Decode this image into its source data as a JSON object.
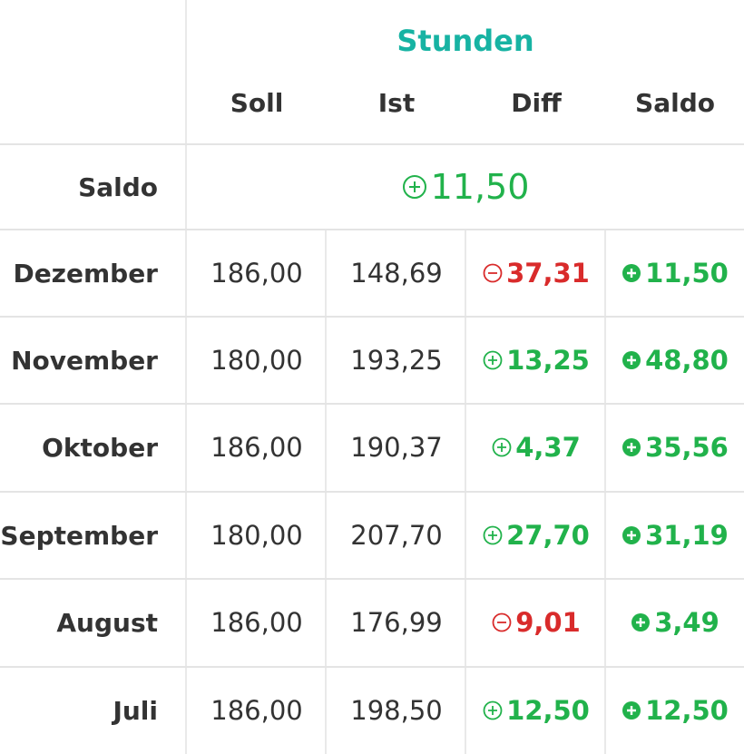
{
  "header": {
    "group_title": "Stunden",
    "columns": [
      "Soll",
      "Ist",
      "Diff",
      "Saldo"
    ]
  },
  "saldo_row": {
    "label": "Saldo",
    "value": "11,50",
    "icon": "plus-circle-outline-icon",
    "color": "#21b24b"
  },
  "rows": [
    {
      "month": "Dezember",
      "soll": "186,00",
      "ist": "148,69",
      "diff": "37,31",
      "diff_sign": "negative",
      "saldo": "11,50"
    },
    {
      "month": "November",
      "soll": "180,00",
      "ist": "193,25",
      "diff": "13,25",
      "diff_sign": "positive",
      "saldo": "48,80"
    },
    {
      "month": "Oktober",
      "soll": "186,00",
      "ist": "190,37",
      "diff": "4,37",
      "diff_sign": "positive",
      "saldo": "35,56"
    },
    {
      "month": "September",
      "soll": "180,00",
      "ist": "207,70",
      "diff": "27,70",
      "diff_sign": "positive",
      "saldo": "31,19"
    },
    {
      "month": "August",
      "soll": "186,00",
      "ist": "176,99",
      "diff": "9,01",
      "diff_sign": "negative",
      "saldo": "3,49"
    },
    {
      "month": "Juli",
      "soll": "186,00",
      "ist": "198,50",
      "diff": "12,50",
      "diff_sign": "positive",
      "saldo": "12,50"
    }
  ],
  "colors": {
    "accent": "#17b3a3",
    "positive": "#21b24b",
    "negative": "#d92b2b"
  }
}
